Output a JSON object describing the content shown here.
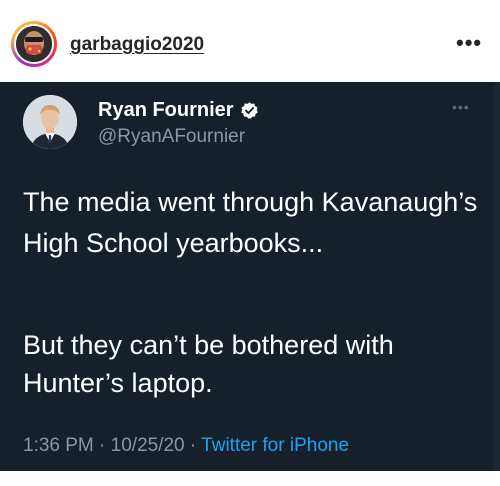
{
  "instagram": {
    "username": "garbaggio2020",
    "more_icon": "more-horizontal-icon"
  },
  "tweet": {
    "author_name": "Ryan Fournier",
    "handle": "@RyanAFournier",
    "verified": true,
    "text_paragraph_1": "The media went through Kavanaugh’s High School yearbooks...",
    "text_paragraph_2": "But they can’t be bothered with Hunter’s laptop.",
    "time": "1:36 PM",
    "date": "10/25/20",
    "separator": "·",
    "source": "Twitter for iPhone"
  },
  "colors": {
    "tweet_background": "#15202b",
    "secondary_text": "#8899a6",
    "link_blue": "#1da1f2"
  }
}
